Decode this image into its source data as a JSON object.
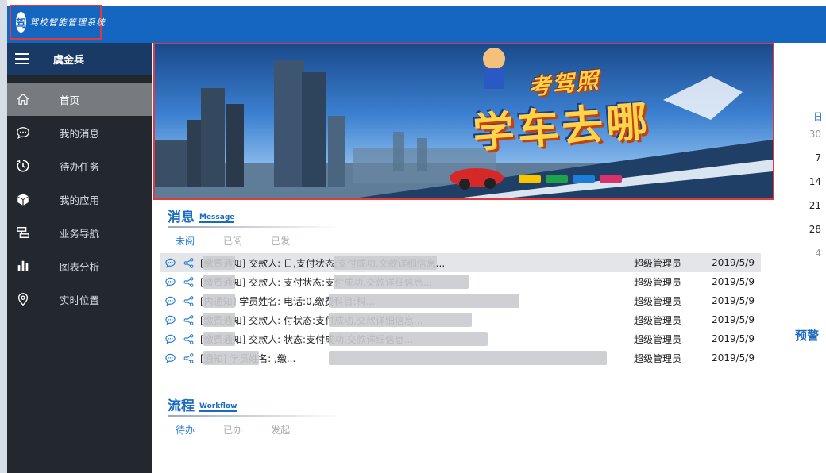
{
  "header": {
    "logo_badge": "驾",
    "logo_text": "驾校智能管理系统"
  },
  "sidebar": {
    "user": "虞金兵",
    "items": [
      {
        "label": "首页",
        "icon": "home-icon",
        "active": true
      },
      {
        "label": "我的消息",
        "icon": "chat-icon",
        "active": false
      },
      {
        "label": "待办任务",
        "icon": "timer-icon",
        "active": false
      },
      {
        "label": "我的应用",
        "icon": "cube-icon",
        "active": false
      },
      {
        "label": "业务导航",
        "icon": "nav-icon",
        "active": false
      },
      {
        "label": "图表分析",
        "icon": "bar-chart-icon",
        "active": false
      },
      {
        "label": "实时位置",
        "icon": "location-pin-icon",
        "active": false
      }
    ]
  },
  "banner": {
    "small_title": "考驾照",
    "big_title": "学车去哪"
  },
  "calendar": {
    "header": "日",
    "days": [
      "30",
      "7",
      "14",
      "21",
      "28",
      "4"
    ]
  },
  "warning_label": "预警",
  "messages": {
    "title": "消息",
    "subtitle": "Message",
    "tabs": [
      "未阅",
      "已阅",
      "已发"
    ],
    "rows": [
      {
        "text": "[缴费通知] 交款人:          日,支付状态:支付成功,交款详细信息...",
        "user": "超级管理员",
        "date": "2019/5/9"
      },
      {
        "text": "[缴费通知] 交款人:          支付状态:支付成功,交款详细信息...",
        "user": "超级管理员",
        "date": "2019/5/9"
      },
      {
        "text": "[内通知] 学员姓名:          电话:0,缴费科目:科...",
        "user": "超级管理员",
        "date": "2019/5/9"
      },
      {
        "text": "[缴费通知] 交款人:          付状态:支付成功,交款详细信息...",
        "user": "超级管理员",
        "date": "2019/5/9"
      },
      {
        "text": "[缴费通知] 交款人:          状态:支付成功,交款详细信息...",
        "user": "超级管理员",
        "date": "2019/5/9"
      },
      {
        "text": "[通知] 学员姓名:          ,缴...",
        "user": "超级管理员",
        "date": "2019/5/9"
      }
    ]
  },
  "workflow": {
    "title": "流程",
    "subtitle": "Workflow",
    "tabs": [
      "待办",
      "已办",
      "发起"
    ]
  }
}
